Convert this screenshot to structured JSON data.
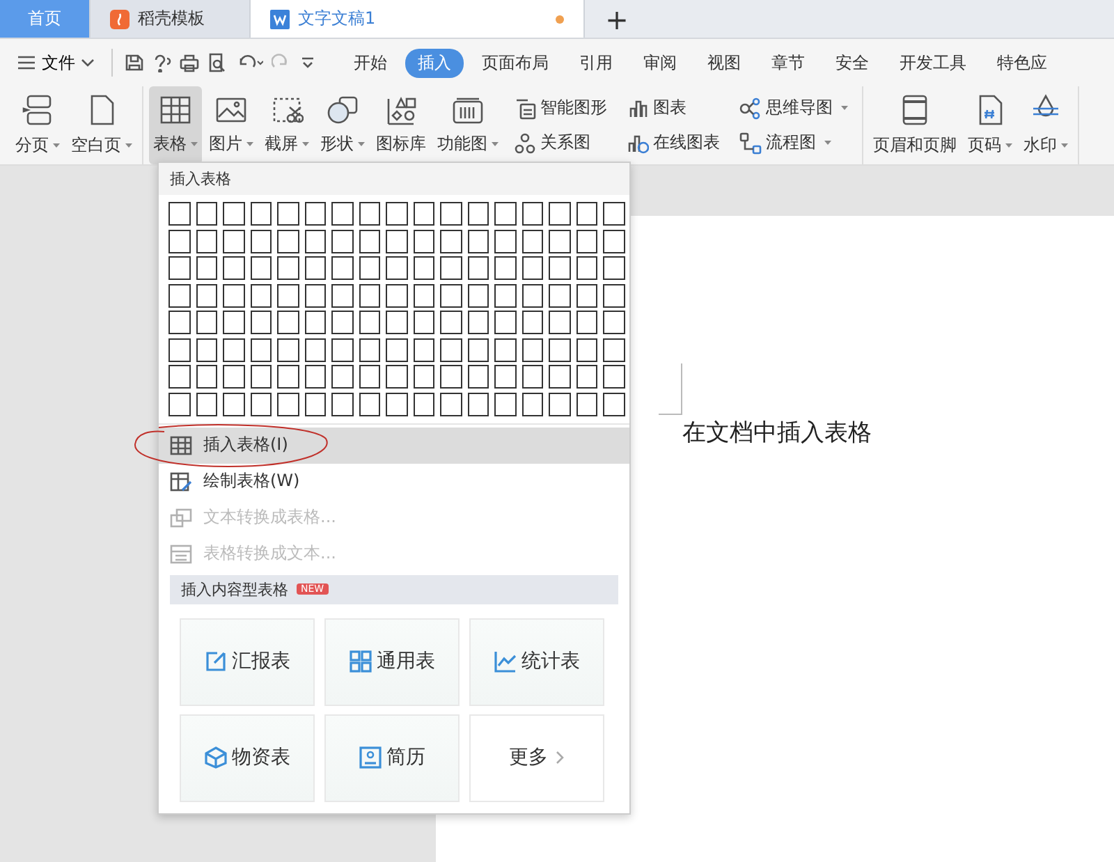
{
  "tabs": [
    {
      "label": "首页",
      "kind": "home",
      "selected": false
    },
    {
      "label": "稻壳模板",
      "kind": "template",
      "selected": false
    },
    {
      "label": "文字文稿1",
      "kind": "doc",
      "selected": true,
      "modified": true
    }
  ],
  "add_tab": "+",
  "menu_bar": {
    "file_menu": "文件",
    "tabs": [
      {
        "label": "开始",
        "selected": false
      },
      {
        "label": "插入",
        "selected": true
      },
      {
        "label": "页面布局",
        "selected": false
      },
      {
        "label": "引用",
        "selected": false
      },
      {
        "label": "审阅",
        "selected": false
      },
      {
        "label": "视图",
        "selected": false
      },
      {
        "label": "章节",
        "selected": false
      },
      {
        "label": "安全",
        "selected": false
      },
      {
        "label": "开发工具",
        "selected": false
      },
      {
        "label": "特色应",
        "selected": false
      }
    ]
  },
  "ribbon": {
    "groups": [
      {
        "items": [
          {
            "kind": "big",
            "label": "分页",
            "dropdown": true,
            "active": false
          },
          {
            "kind": "big",
            "label": "空白页",
            "dropdown": true,
            "active": false
          }
        ]
      },
      {
        "items": [
          {
            "kind": "big",
            "label": "表格",
            "dropdown": true,
            "active": true
          },
          {
            "kind": "big",
            "label": "图片",
            "dropdown": true,
            "active": false
          },
          {
            "kind": "big",
            "label": "截屏",
            "dropdown": true,
            "active": false
          },
          {
            "kind": "big",
            "label": "形状",
            "dropdown": true,
            "active": false
          },
          {
            "kind": "big",
            "label": "图标库",
            "dropdown": false,
            "active": false
          },
          {
            "kind": "big",
            "label": "功能图",
            "dropdown": true,
            "active": false
          },
          {
            "kind": "small",
            "label": "智能图形",
            "dropdown": false
          },
          {
            "kind": "small",
            "label": "关系图",
            "dropdown": false
          },
          {
            "kind": "small",
            "label": "图表",
            "dropdown": false
          },
          {
            "kind": "small",
            "label": "在线图表",
            "dropdown": false
          },
          {
            "kind": "small",
            "label": "思维导图",
            "dropdown": true
          },
          {
            "kind": "small",
            "label": "流程图",
            "dropdown": true
          }
        ]
      },
      {
        "items": [
          {
            "kind": "big",
            "label": "页眉和页脚",
            "dropdown": false,
            "active": false
          },
          {
            "kind": "big",
            "label": "页码",
            "dropdown": true,
            "active": false
          },
          {
            "kind": "big",
            "label": "水印",
            "dropdown": true,
            "active": false
          }
        ]
      }
    ]
  },
  "table_menu": {
    "title": "插入表格",
    "items": [
      {
        "label": "插入表格(I)",
        "selected": true,
        "disabled": false,
        "circled": true
      },
      {
        "label": "绘制表格(W)",
        "selected": false,
        "disabled": false,
        "circled": false
      },
      {
        "label": "文本转换成表格...",
        "selected": false,
        "disabled": true,
        "circled": false
      },
      {
        "label": "表格转换成文本...",
        "selected": false,
        "disabled": true,
        "circled": false
      }
    ],
    "section": {
      "title": "插入内容型表格",
      "badge": "NEW"
    },
    "templates": [
      {
        "kind": "report",
        "label": "汇报表"
      },
      {
        "kind": "general",
        "label": "通用表"
      },
      {
        "kind": "stats",
        "label": "统计表"
      },
      {
        "kind": "supplies",
        "label": "物资表"
      },
      {
        "kind": "resume",
        "label": "简历"
      },
      {
        "kind": "more",
        "label": "更多"
      }
    ]
  },
  "document": {
    "text": "在文档中插入表格"
  }
}
